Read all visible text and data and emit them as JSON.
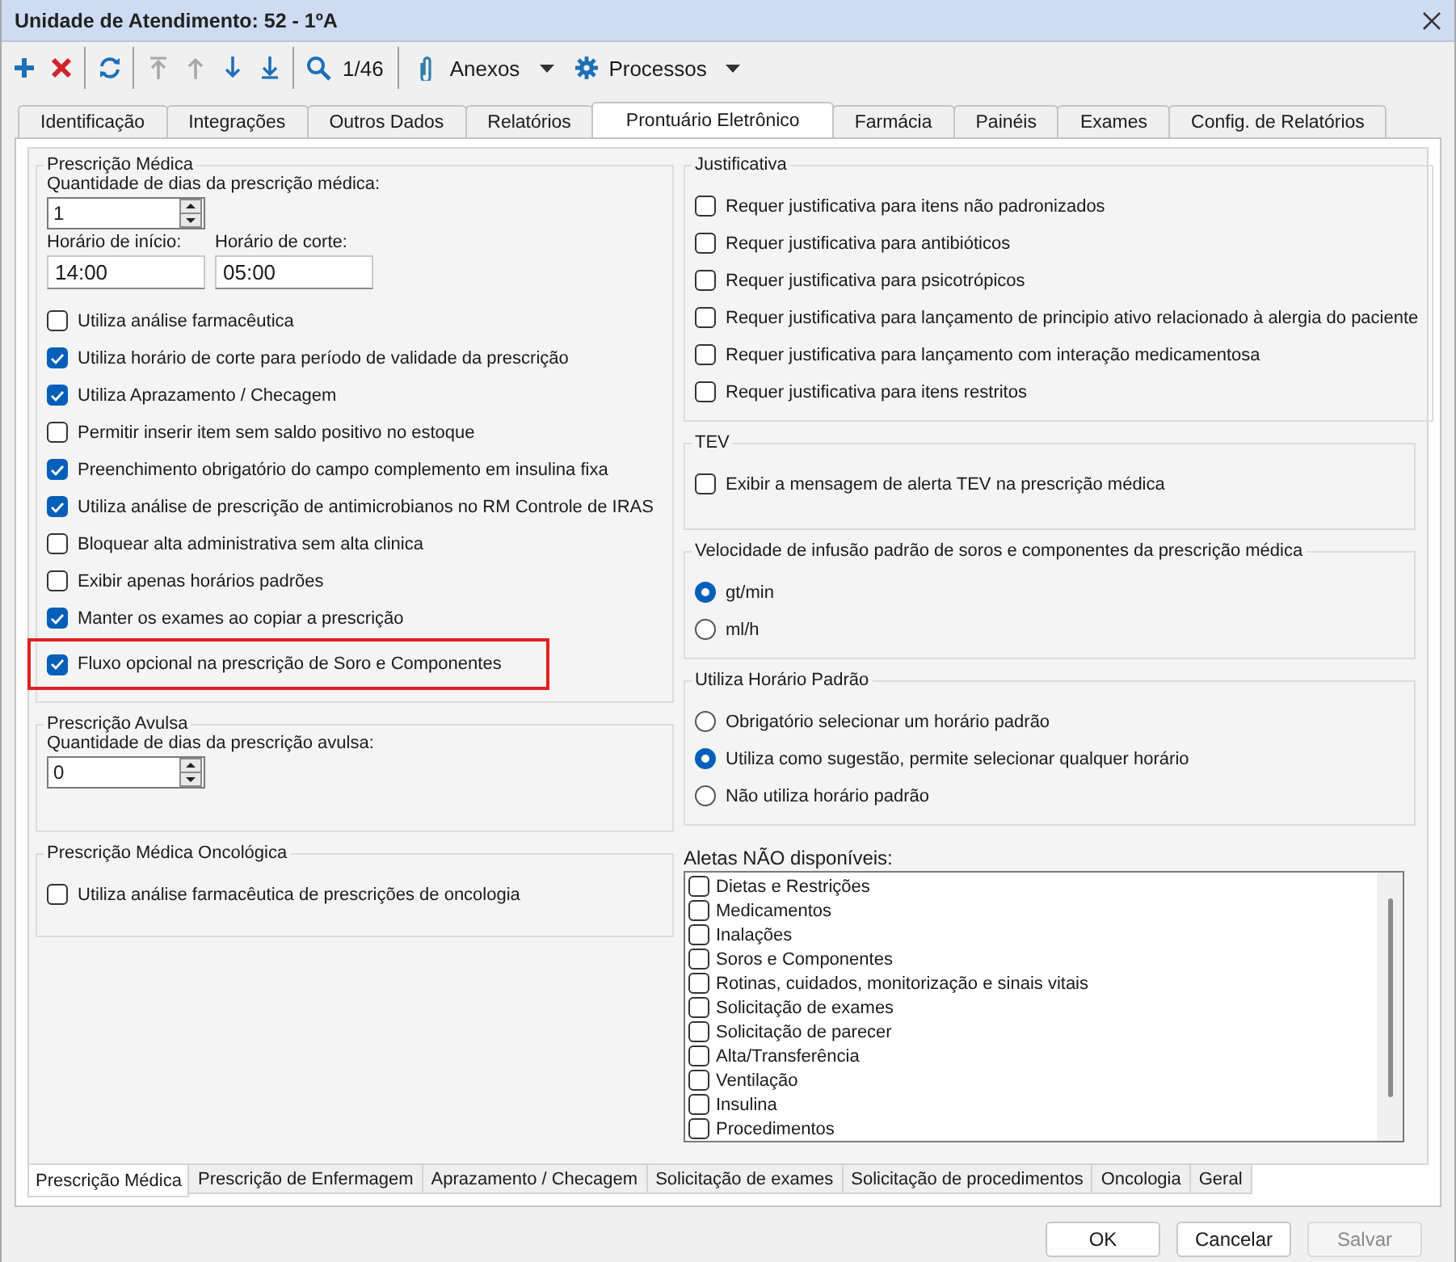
{
  "window": {
    "title": "Unidade de Atendimento: 52 - 1ºA"
  },
  "toolbar": {
    "button_groups": [
      [
        {
          "kind": "add",
          "disabled": false
        },
        {
          "kind": "delete",
          "disabled": false
        }
      ],
      [
        {
          "kind": "refresh",
          "disabled": false
        }
      ],
      [
        {
          "kind": "first",
          "disabled": true
        },
        {
          "kind": "up",
          "disabled": true
        },
        {
          "kind": "down",
          "disabled": false
        },
        {
          "kind": "last",
          "disabled": false
        }
      ],
      [
        {
          "kind": "search",
          "disabled": false
        }
      ]
    ],
    "counter": "1/46",
    "menus": [
      {
        "kind": "attachments",
        "label": "Anexos"
      },
      {
        "kind": "processes",
        "label": "Processos"
      }
    ]
  },
  "tabs": [
    {
      "label": "Identificação",
      "selected": false
    },
    {
      "label": "Integrações",
      "selected": false
    },
    {
      "label": "Outros Dados",
      "selected": false
    },
    {
      "label": "Relatórios",
      "selected": false
    },
    {
      "label": "Prontuário Eletrônico",
      "selected": true
    },
    {
      "label": "Farmácia",
      "selected": false
    },
    {
      "label": "Painéis",
      "selected": false
    },
    {
      "label": "Exames",
      "selected": false
    },
    {
      "label": "Config. de Relatórios",
      "selected": false
    }
  ],
  "left_groups": [
    {
      "title": "Prescrição Médica",
      "kind": "checkboxes",
      "field_rows": [
        [
          {
            "kind": "spinner",
            "label": "Quantidade de dias da prescrição médica:",
            "value": "1"
          }
        ],
        [
          {
            "kind": "text",
            "label": "Horário de início:",
            "value": "14:00"
          },
          {
            "kind": "text",
            "label": "Horário de corte:",
            "value": "05:00"
          }
        ]
      ],
      "options": [
        {
          "label": "Utiliza análise farmacêutica",
          "checked": false,
          "highlighted": false
        },
        {
          "label": "Utiliza horário de corte para período de validade da prescrição",
          "checked": true,
          "highlighted": false
        },
        {
          "label": "Utiliza Aprazamento / Checagem",
          "checked": true,
          "highlighted": false
        },
        {
          "label": "Permitir inserir item sem saldo positivo no estoque",
          "checked": false,
          "highlighted": false
        },
        {
          "label": "Preenchimento obrigatório do campo complemento em insulina fixa",
          "checked": true,
          "highlighted": false
        },
        {
          "label": "Utiliza análise de prescrição de antimicrobianos no RM Controle de IRAS",
          "checked": true,
          "highlighted": false
        },
        {
          "label": "Bloquear alta administrativa sem alta clinica",
          "checked": false,
          "highlighted": false
        },
        {
          "label": "Exibir apenas horários padrões",
          "checked": false,
          "highlighted": false
        },
        {
          "label": "Manter os exames ao copiar a prescrição",
          "checked": true,
          "highlighted": false
        },
        {
          "label": "Fluxo opcional na prescrição de Soro e Componentes",
          "checked": true,
          "highlighted": true
        }
      ]
    },
    {
      "title": "Prescrição Avulsa",
      "field_rows": [
        [
          {
            "kind": "spinner",
            "label": "Quantidade de dias da prescrição avulsa:",
            "value": "0"
          }
        ]
      ]
    },
    {
      "title": "Prescrição Médica Oncológica",
      "kind": "checkboxes",
      "options": [
        {
          "label": "Utiliza análise farmacêutica de prescrições de oncologia",
          "checked": false,
          "highlighted": false
        }
      ]
    }
  ],
  "right_groups": [
    {
      "title": "Justificativa",
      "kind": "checkboxes",
      "options": [
        {
          "label": "Requer justificativa para itens não padronizados",
          "checked": false,
          "highlighted": false
        },
        {
          "label": "Requer justificativa para antibióticos",
          "checked": false,
          "highlighted": false
        },
        {
          "label": "Requer justificativa para psicotrópicos",
          "checked": false,
          "highlighted": false
        },
        {
          "label": "Requer justificativa para lançamento de principio ativo relacionado à alergia do paciente",
          "checked": false,
          "highlighted": false
        },
        {
          "label": "Requer justificativa para lançamento com interação medicamentosa",
          "checked": false,
          "highlighted": false
        },
        {
          "label": "Requer justificativa para itens restritos",
          "checked": false,
          "highlighted": false
        }
      ]
    },
    {
      "title": "TEV",
      "kind": "checkboxes",
      "options": [
        {
          "label": "Exibir a mensagem de alerta TEV na prescrição médica",
          "checked": false,
          "highlighted": false
        }
      ]
    },
    {
      "title": "Velocidade de infusão padrão de soros e componentes da prescrição médica",
      "kind": "radios",
      "options": [
        {
          "label": "gt/min",
          "selected": true
        },
        {
          "label": "ml/h",
          "selected": false
        }
      ]
    },
    {
      "title": "Utiliza Horário Padrão",
      "kind": "radios",
      "options": [
        {
          "label": "Obrigatório selecionar um horário padrão",
          "selected": false
        },
        {
          "label": "Utiliza como sugestão, permite selecionar qualquer horário",
          "selected": true
        },
        {
          "label": "Não utiliza horário padrão",
          "selected": false
        }
      ]
    }
  ],
  "unavailable_tabs": {
    "label": "Aletas NÃO disponíveis:",
    "items": [
      {
        "label": "Dietas e Restrições",
        "checked": false
      },
      {
        "label": "Medicamentos",
        "checked": false
      },
      {
        "label": "Inalações",
        "checked": false
      },
      {
        "label": "Soros e Componentes",
        "checked": false
      },
      {
        "label": "Rotinas, cuidados, monitorização e sinais vitais",
        "checked": false
      },
      {
        "label": "Solicitação de exames",
        "checked": false
      },
      {
        "label": "Solicitação de parecer",
        "checked": false
      },
      {
        "label": "Alta/Transferência",
        "checked": false
      },
      {
        "label": "Ventilação",
        "checked": false
      },
      {
        "label": "Insulina",
        "checked": false
      },
      {
        "label": "Procedimentos",
        "checked": false
      }
    ]
  },
  "bottom_tabs": [
    {
      "label": "Prescrição Médica",
      "selected": true
    },
    {
      "label": "Prescrição de Enfermagem",
      "selected": false
    },
    {
      "label": "Aprazamento / Checagem",
      "selected": false
    },
    {
      "label": "Solicitação de exames",
      "selected": false
    },
    {
      "label": "Solicitação de procedimentos",
      "selected": false
    },
    {
      "label": "Oncologia",
      "selected": false
    },
    {
      "label": "Geral",
      "selected": false
    }
  ],
  "buttons": [
    {
      "label": "OK",
      "disabled": false
    },
    {
      "label": "Cancelar",
      "disabled": false
    },
    {
      "label": "Salvar",
      "disabled": true
    }
  ]
}
